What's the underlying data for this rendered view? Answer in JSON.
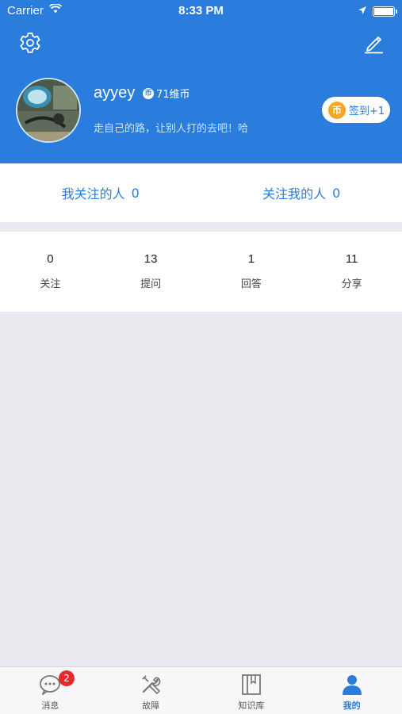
{
  "status_bar": {
    "carrier": "Carrier",
    "time": "8:33 PM"
  },
  "profile": {
    "username": "ayyey",
    "coin_icon": "币",
    "coins": "71维币",
    "bio": "走自己的路，让别人打的去吧！哈",
    "checkin": {
      "coin_icon": "币",
      "label": "签到+1"
    }
  },
  "follow": {
    "following_label": "我关注的人",
    "following_count": "0",
    "followers_label": "关注我的人",
    "followers_count": "0"
  },
  "stats": [
    {
      "value": "0",
      "label": "关注"
    },
    {
      "value": "13",
      "label": "提问"
    },
    {
      "value": "1",
      "label": "回答"
    },
    {
      "value": "11",
      "label": "分享"
    }
  ],
  "tabbar": {
    "tabs": [
      {
        "label": "消息",
        "icon": "message-icon",
        "badge": "2"
      },
      {
        "label": "故障",
        "icon": "tools-icon"
      },
      {
        "label": "知识库",
        "icon": "book-icon"
      },
      {
        "label": "我的",
        "icon": "person-icon"
      }
    ],
    "active": "我的"
  },
  "colors": {
    "primary": "#2a7ddd",
    "background": "#eaeaf0",
    "badge": "#e82a2a",
    "coin": "#f5a623"
  }
}
